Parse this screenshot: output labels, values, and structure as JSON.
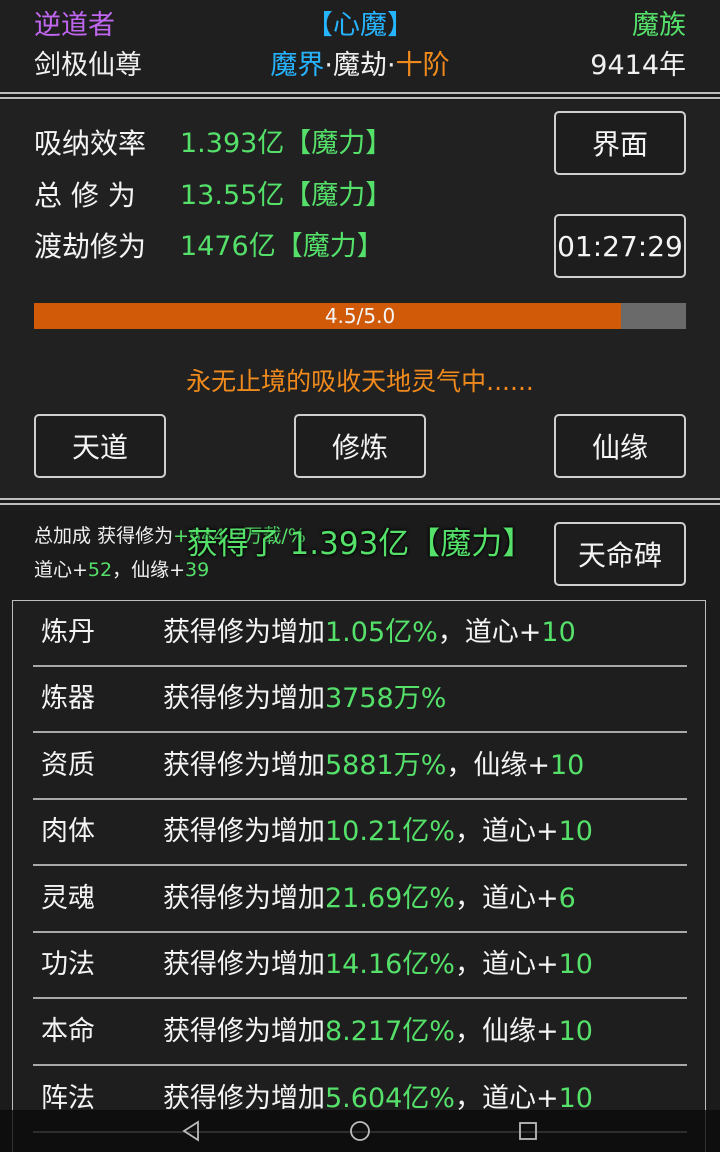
{
  "header": {
    "role": "逆道者",
    "name": "剑极仙尊",
    "title": "【心魔】",
    "realm": {
      "part1": "魔界",
      "sep1": "·",
      "part2": "魔劫",
      "sep2": "·",
      "part3": "十阶"
    },
    "faction": "魔族",
    "years": "9414年"
  },
  "stats": [
    {
      "label": "吸纳效率",
      "value": "1.393亿【魔力】"
    },
    {
      "label": "总 修 为",
      "value": "13.55亿【魔力】"
    },
    {
      "label": "渡劫修为",
      "value": "1476亿【魔力】"
    }
  ],
  "buttons": {
    "interface": "界面",
    "timer": "01:27:29",
    "tiandao": "天道",
    "xiulian": "修炼",
    "xianyuan": "仙缘",
    "tianming": "天命碑"
  },
  "progress": {
    "text": "4.5/5.0",
    "value": 4.5,
    "max": 5.0
  },
  "status_message": "永无止境的吸收天地灵气中......",
  "bonus": {
    "total_label": "总加成",
    "total_text": "获得修为",
    "total_value": "+644.2万载/%",
    "stats_line": {
      "daoxin_label": "道心+",
      "daoxin_value": "52",
      "sep": "，",
      "xianyuan_label": "仙缘+",
      "xianyuan_value": "39"
    },
    "toast": "获得了 1.393亿【魔力】"
  },
  "rows": [
    {
      "name": "炼丹",
      "prefix": "获得修为增加",
      "amount": "1.05亿%",
      "extra_label": "，道心+",
      "extra_value": "10"
    },
    {
      "name": "炼器",
      "prefix": "获得修为增加",
      "amount": "3758万%",
      "extra_label": "",
      "extra_value": ""
    },
    {
      "name": "资质",
      "prefix": "获得修为增加",
      "amount": "5881万%",
      "extra_label": "，仙缘+",
      "extra_value": "10"
    },
    {
      "name": "肉体",
      "prefix": "获得修为增加",
      "amount": "10.21亿%",
      "extra_label": "，道心+",
      "extra_value": "10"
    },
    {
      "name": "灵魂",
      "prefix": "获得修为增加",
      "amount": "21.69亿%",
      "extra_label": "，道心+",
      "extra_value": "6"
    },
    {
      "name": "功法",
      "prefix": "获得修为增加",
      "amount": "14.16亿%",
      "extra_label": "，道心+",
      "extra_value": "10"
    },
    {
      "name": "本命",
      "prefix": "获得修为增加",
      "amount": "8.217亿%",
      "extra_label": "，仙缘+",
      "extra_value": "10"
    },
    {
      "name": "阵法",
      "prefix": "获得修为增加",
      "amount": "5.604亿%",
      "extra_label": "，道心+",
      "extra_value": "10"
    }
  ],
  "icons": {
    "back": "back-triangle-icon",
    "home": "home-circle-icon",
    "recent": "recent-square-icon"
  },
  "colors": {
    "green": "#55e06a",
    "orange": "#f08a1c",
    "blue": "#27b4ff",
    "purple": "#c066f0",
    "progress_fill": "#d05a08"
  }
}
